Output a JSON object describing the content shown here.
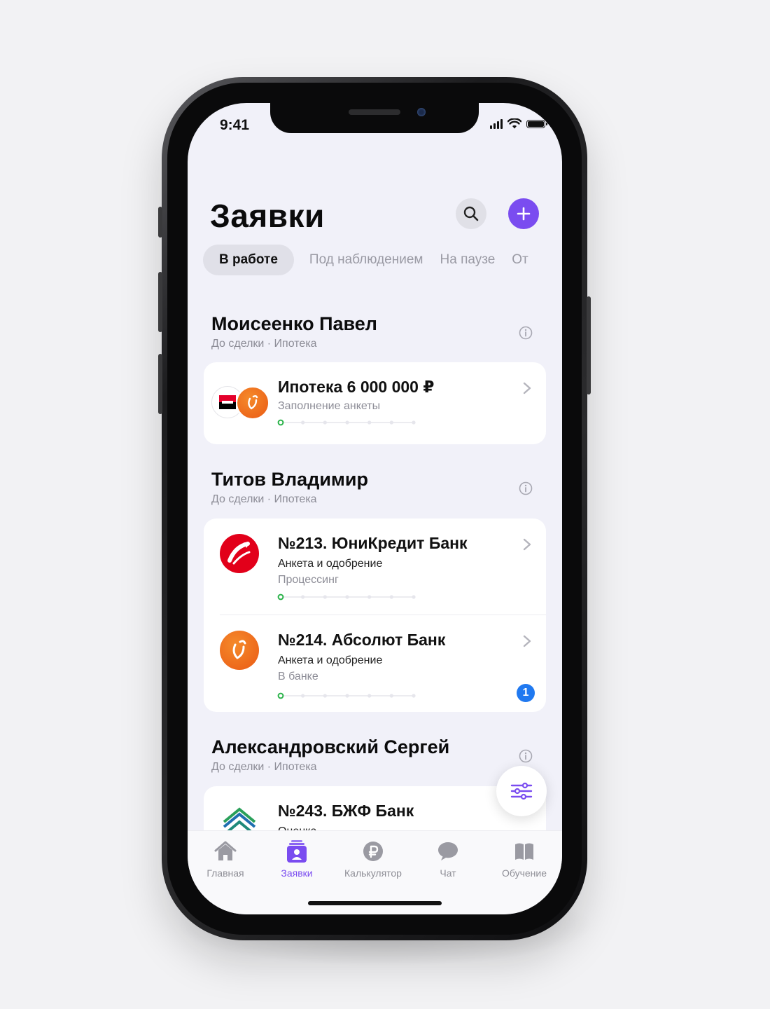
{
  "status_bar": {
    "time": "9:41"
  },
  "header": {
    "title": "Заявки",
    "search_icon": "search-icon",
    "add_icon": "plus-icon"
  },
  "tabs": [
    {
      "label": "В работе",
      "active": true
    },
    {
      "label": "Под наблюдением",
      "active": false
    },
    {
      "label": "На паузе",
      "active": false
    },
    {
      "label": "От",
      "active": false
    }
  ],
  "groups": [
    {
      "name": "Моисеенко Павел",
      "subtitle": "До сделки · Ипотека",
      "items": [
        {
          "title": "Ипотека 6 000 000 ₽",
          "status": "Заполнение анкеты",
          "progress_step": 1,
          "progress_total": 7
        }
      ]
    },
    {
      "name": "Титов Владимир",
      "subtitle": "До сделки · Ипотека",
      "items": [
        {
          "title": "№213. ЮниКредит Банк",
          "stage": "Анкета и одобрение",
          "status": "Процессинг",
          "progress_step": 1,
          "progress_total": 7
        },
        {
          "title": "№214. Абсолют Банк",
          "stage": "Анкета и одобрение",
          "status": "В банке",
          "progress_step": 1,
          "progress_total": 7,
          "badge": "1"
        }
      ]
    },
    {
      "name": "Александровский Сергей",
      "subtitle": "До сделки · Ипотека",
      "items": [
        {
          "title": "№243. БЖФ Банк",
          "stage": "Оценка"
        }
      ]
    }
  ],
  "tabbar": [
    {
      "label": "Главная",
      "icon": "home-icon",
      "active": false
    },
    {
      "label": "Заявки",
      "icon": "applications-icon",
      "active": true
    },
    {
      "label": "Калькулятор",
      "icon": "ruble-icon",
      "active": false
    },
    {
      "label": "Чат",
      "icon": "chat-icon",
      "active": false
    },
    {
      "label": "Обучение",
      "icon": "book-icon",
      "active": false
    }
  ],
  "colors": {
    "accent": "#7a4cf0",
    "badge": "#2079f0",
    "background": "#f1f1f9",
    "progress_done": "#2bb34a"
  }
}
